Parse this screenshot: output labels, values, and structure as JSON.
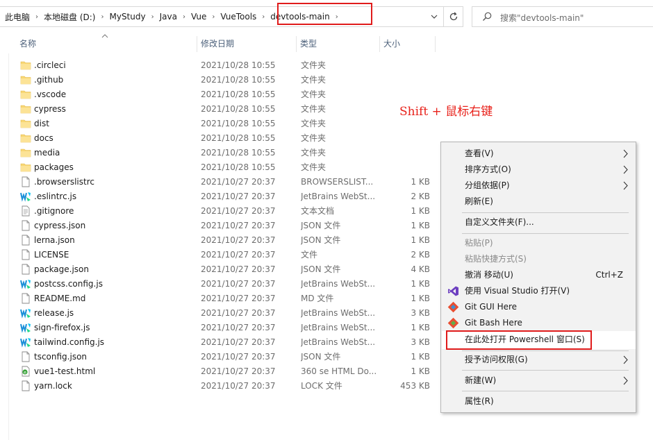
{
  "address": {
    "crumbs": [
      "此电脑",
      "本地磁盘 (D:)",
      "MyStudy",
      "Java",
      "Vue",
      "VueTools",
      "devtools-main"
    ],
    "search_placeholder": "搜索\"devtools-main\""
  },
  "columns": {
    "name": "名称",
    "date": "修改日期",
    "type": "类型",
    "size": "大小"
  },
  "files": [
    {
      "name": ".circleci",
      "date": "2021/10/28 10:55",
      "type": "文件夹",
      "size": "",
      "icon": "folder"
    },
    {
      "name": ".github",
      "date": "2021/10/28 10:55",
      "type": "文件夹",
      "size": "",
      "icon": "folder"
    },
    {
      "name": ".vscode",
      "date": "2021/10/28 10:55",
      "type": "文件夹",
      "size": "",
      "icon": "folder"
    },
    {
      "name": "cypress",
      "date": "2021/10/28 10:55",
      "type": "文件夹",
      "size": "",
      "icon": "folder"
    },
    {
      "name": "dist",
      "date": "2021/10/28 10:55",
      "type": "文件夹",
      "size": "",
      "icon": "folder"
    },
    {
      "name": "docs",
      "date": "2021/10/28 10:55",
      "type": "文件夹",
      "size": "",
      "icon": "folder"
    },
    {
      "name": "media",
      "date": "2021/10/28 10:55",
      "type": "文件夹",
      "size": "",
      "icon": "folder"
    },
    {
      "name": "packages",
      "date": "2021/10/28 10:55",
      "type": "文件夹",
      "size": "",
      "icon": "folder"
    },
    {
      "name": ".browserslistrc",
      "date": "2021/10/27 20:37",
      "type": "BROWSERSLIST...",
      "size": "1 KB",
      "icon": "file"
    },
    {
      "name": ".eslintrc.js",
      "date": "2021/10/27 20:37",
      "type": "JetBrains WebSt...",
      "size": "2 KB",
      "icon": "webstorm"
    },
    {
      "name": ".gitignore",
      "date": "2021/10/27 20:37",
      "type": "文本文档",
      "size": "1 KB",
      "icon": "textfile"
    },
    {
      "name": "cypress.json",
      "date": "2021/10/27 20:37",
      "type": "JSON 文件",
      "size": "1 KB",
      "icon": "file"
    },
    {
      "name": "lerna.json",
      "date": "2021/10/27 20:37",
      "type": "JSON 文件",
      "size": "1 KB",
      "icon": "file"
    },
    {
      "name": "LICENSE",
      "date": "2021/10/27 20:37",
      "type": "文件",
      "size": "2 KB",
      "icon": "file"
    },
    {
      "name": "package.json",
      "date": "2021/10/27 20:37",
      "type": "JSON 文件",
      "size": "4 KB",
      "icon": "file"
    },
    {
      "name": "postcss.config.js",
      "date": "2021/10/27 20:37",
      "type": "JetBrains WebSt...",
      "size": "1 KB",
      "icon": "webstorm"
    },
    {
      "name": "README.md",
      "date": "2021/10/27 20:37",
      "type": "MD 文件",
      "size": "1 KB",
      "icon": "file"
    },
    {
      "name": "release.js",
      "date": "2021/10/27 20:37",
      "type": "JetBrains WebSt...",
      "size": "3 KB",
      "icon": "webstorm"
    },
    {
      "name": "sign-firefox.js",
      "date": "2021/10/27 20:37",
      "type": "JetBrains WebSt...",
      "size": "1 KB",
      "icon": "webstorm"
    },
    {
      "name": "tailwind.config.js",
      "date": "2021/10/27 20:37",
      "type": "JetBrains WebSt...",
      "size": "3 KB",
      "icon": "webstorm"
    },
    {
      "name": "tsconfig.json",
      "date": "2021/10/27 20:37",
      "type": "JSON 文件",
      "size": "1 KB",
      "icon": "file"
    },
    {
      "name": "vue1-test.html",
      "date": "2021/10/27 20:37",
      "type": "360 se HTML Do...",
      "size": "1 KB",
      "icon": "html"
    },
    {
      "name": "yarn.lock",
      "date": "2021/10/27 20:37",
      "type": "LOCK 文件",
      "size": "453 KB",
      "icon": "file"
    }
  ],
  "annotation": "Shift + 鼠标右键",
  "context_menu": {
    "view": "查看(V)",
    "sort": "排序方式(O)",
    "group": "分组依据(P)",
    "refresh": "刷新(E)",
    "customize": "自定义文件夹(F)...",
    "paste": "粘贴(P)",
    "paste_shortcut": "粘贴快捷方式(S)",
    "undo": "撤消 移动(U)",
    "undo_shortcut": "Ctrl+Z",
    "open_vs": "使用 Visual Studio 打开(V)",
    "git_gui": "Git GUI Here",
    "git_bash": "Git Bash Here",
    "powershell": "在此处打开 Powershell 窗口(S)",
    "grant_access": "授予访问权限(G)",
    "new": "新建(W)",
    "properties": "属性(R)"
  },
  "colors": {
    "highlight_red": "#e01b1b",
    "annotation_red": "#e8211a",
    "folder_yellow": "#f8d775",
    "header_text": "#4c607a"
  }
}
